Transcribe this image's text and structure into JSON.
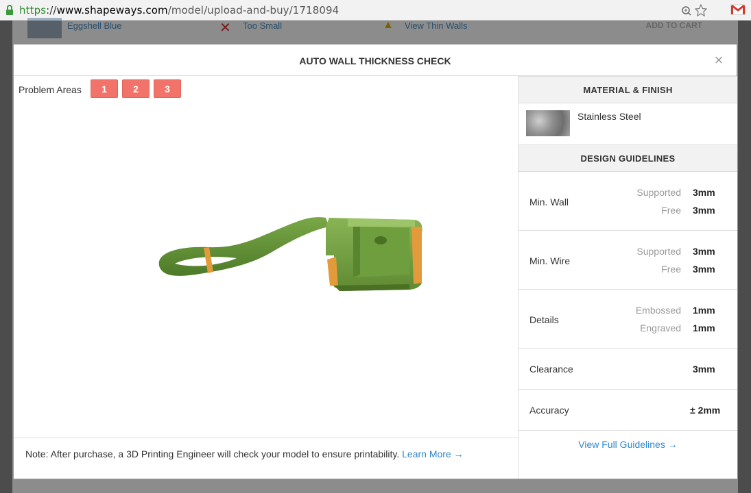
{
  "browser": {
    "url_scheme": "https",
    "url_sep": "://",
    "url_host": "www.shapeways.com",
    "url_path": "/model/upload-and-buy/1718094"
  },
  "background": {
    "material": "Eggshell Blue",
    "status": "Too Small",
    "view_thin": "View Thin Walls",
    "add_to_cart": "ADD TO CART"
  },
  "modal": {
    "title": "AUTO WALL THICKNESS CHECK",
    "close": "×",
    "problem_areas_label": "Problem Areas",
    "problem_areas": [
      "1",
      "2",
      "3"
    ],
    "note": "Note: After purchase, a 3D Printing Engineer will check your model to ensure printability.",
    "learn_more": "Learn More →"
  },
  "material": {
    "heading": "MATERIAL & FINISH",
    "name": "Stainless Steel"
  },
  "guidelines": {
    "heading": "DESIGN GUIDELINES",
    "rows": [
      {
        "name": "Min. Wall",
        "items": [
          {
            "sub": "Supported",
            "val": "3mm"
          },
          {
            "sub": "Free",
            "val": "3mm"
          }
        ]
      },
      {
        "name": "Min. Wire",
        "items": [
          {
            "sub": "Supported",
            "val": "3mm"
          },
          {
            "sub": "Free",
            "val": "3mm"
          }
        ]
      },
      {
        "name": "Details",
        "items": [
          {
            "sub": "Embossed",
            "val": "1mm"
          },
          {
            "sub": "Engraved",
            "val": "1mm"
          }
        ]
      },
      {
        "name": "Clearance",
        "items": [
          {
            "sub": "",
            "val": "3mm"
          }
        ]
      },
      {
        "name": "Accuracy",
        "items": [
          {
            "sub": "",
            "val": "± 2mm"
          }
        ]
      }
    ],
    "view_full": "View Full Guidelines →"
  },
  "colors": {
    "problem_button": "#f2736a",
    "link": "#2f87c9",
    "model_green": "#6a9a3a",
    "model_orange": "#e8a040"
  }
}
